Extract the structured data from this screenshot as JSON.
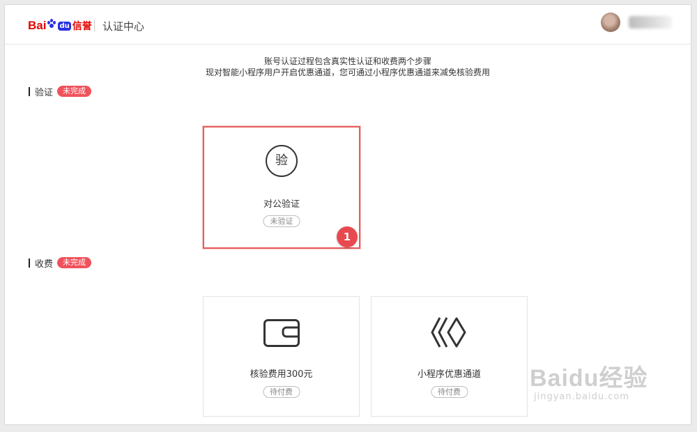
{
  "header": {
    "logo": {
      "bai": "Bai",
      "du": "du",
      "xinyu": "信誉"
    },
    "title": "认证中心"
  },
  "notice": {
    "line1": "账号认证过程包含真实性认证和收费两个步骤",
    "line2": "现对智能小程序用户开启优惠通道，您可通过小程序优惠通道来减免核验费用"
  },
  "verification": {
    "label": "验证",
    "badge": "未完成",
    "cards": [
      {
        "icon_char": "验",
        "title": "对公验证",
        "status": "未验证",
        "step_number": "1",
        "selected": true
      }
    ]
  },
  "fee": {
    "label": "收费",
    "badge": "未完成",
    "cards": [
      {
        "icon": "wallet-icon",
        "title": "核验费用300元",
        "status": "待付费"
      },
      {
        "icon": "diamond-chevrons-icon",
        "title": "小程序优惠通道",
        "status": "待付费"
      }
    ]
  },
  "watermark": {
    "main": "Baidu经验",
    "sub": "jingyan.baidu.com"
  },
  "colors": {
    "accent_red": "#f0525b",
    "brand_red": "#e10601",
    "brand_blue": "#2932e1",
    "selection_border": "#e85d5d"
  }
}
